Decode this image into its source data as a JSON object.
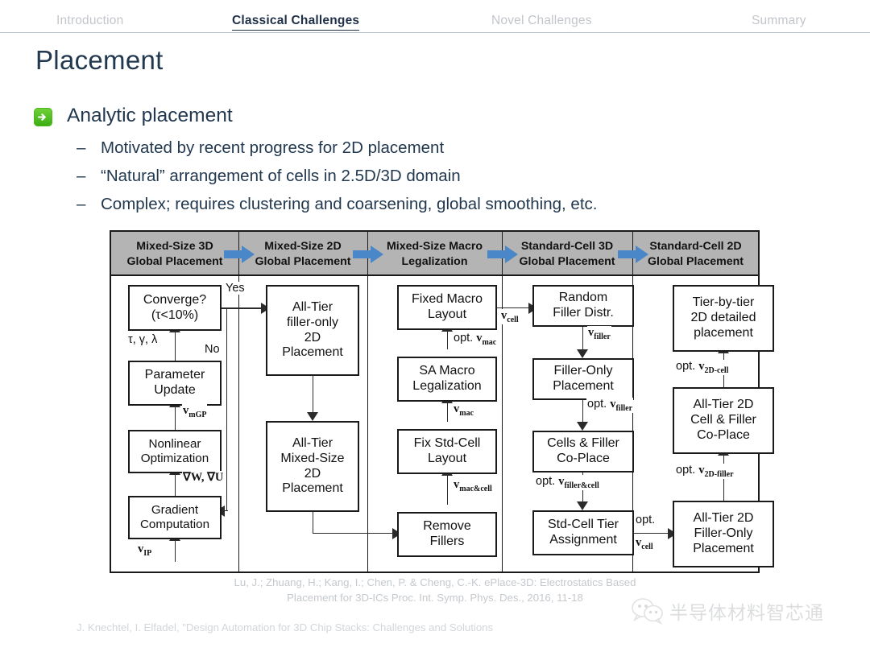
{
  "nav": {
    "items": [
      {
        "label": "Introduction",
        "active": false
      },
      {
        "label": "Classical Challenges",
        "active": true
      },
      {
        "label": "Novel Challenges",
        "active": false
      },
      {
        "label": "Summary",
        "active": false
      }
    ]
  },
  "slide": {
    "title": "Placement",
    "bullet1": "Analytic placement",
    "bullet1_icon": "green-arrow-bullet-icon",
    "sub_bullets": [
      "Motivated by recent progress for 2D placement",
      "“Natural” arrangement of cells in 2.5D/3D domain",
      "Complex; requires clustering and coarsening, global smoothing, etc."
    ]
  },
  "diagram": {
    "headers": [
      {
        "line1": "Mixed-Size 3D",
        "line2": "Global Placement"
      },
      {
        "line1": "Mixed-Size 2D",
        "line2": "Global Placement"
      },
      {
        "line1": "Mixed-Size Macro",
        "line2": "Legalization"
      },
      {
        "line1": "Standard-Cell 3D",
        "line2": "Global Placement"
      },
      {
        "line1": "Standard-Cell 2D",
        "line2": "Global Placement"
      }
    ],
    "col1": {
      "boxes": [
        {
          "line1": "Converge?",
          "line2": "(τ<10%)"
        },
        {
          "line1": "Parameter",
          "line2": "Update"
        },
        {
          "line1": "Nonlinear",
          "line2": "Optimization"
        },
        {
          "line1": "Gradient",
          "line2": "Computation"
        }
      ],
      "edge_params": "τ, γ, λ",
      "edge_vmgp_v": "v",
      "edge_vmgp_sub": "mGP",
      "edge_grad": "∇W, ∇U",
      "edge_vip_v": "v",
      "edge_vip_sub": "IP",
      "yes": "Yes",
      "no": "No"
    },
    "col2": {
      "boxes": [
        {
          "lines": [
            "All-Tier",
            "filler-only",
            "2D",
            "Placement"
          ]
        },
        {
          "lines": [
            "All-Tier",
            "Mixed-Size",
            "2D",
            "Placement"
          ]
        }
      ]
    },
    "col3": {
      "boxes": [
        {
          "line1": "Fixed Macro",
          "line2": "Layout"
        },
        {
          "line1": "SA Macro",
          "line2": "Legalization"
        },
        {
          "line1": "Fix Std-Cell",
          "line2": "Layout"
        },
        {
          "line1": "Remove",
          "line2": "Fillers"
        }
      ],
      "edge_optvmac_pre": "opt. ",
      "edge_optvmac_v": "v",
      "edge_optvmac_sub": "mac",
      "edge_vmac_v": "v",
      "edge_vmac_sub": "mac",
      "edge_vmaccell_v": "v",
      "edge_vmaccell_sub": "mac&cell",
      "edge_vcell_v": "v",
      "edge_vcell_sub": "cell"
    },
    "col4": {
      "boxes": [
        {
          "line1": "Random",
          "line2": "Filler Distr."
        },
        {
          "line1": "Filler-Only",
          "line2": "Placement"
        },
        {
          "line1": "Cells & Filler",
          "line2": "Co-Place"
        },
        {
          "line1": "Std-Cell Tier",
          "line2": "Assignment"
        }
      ],
      "edge_vfiller_v": "v",
      "edge_vfiller_sub": "filler",
      "edge_optvfiller_pre": "opt. ",
      "edge_optvfiller_v": "v",
      "edge_optvfiller_sub": "filler",
      "edge_optvfc_pre": "opt. ",
      "edge_optvfc_v": "v",
      "edge_optvfc_sub": "filler&cell",
      "edge_optvcell_pre": "opt.",
      "edge_optvcell_v": "v",
      "edge_optvcell_sub": "cell"
    },
    "col5": {
      "boxes": [
        {
          "lines": [
            "Tier-by-tier",
            "2D detailed",
            "placement"
          ]
        },
        {
          "lines": [
            "All-Tier 2D",
            "Cell & Filler",
            "Co-Place"
          ]
        },
        {
          "lines": [
            "All-Tier 2D",
            "Filler-Only",
            "Placement"
          ]
        }
      ],
      "edge_2dcell_pre": "opt. ",
      "edge_2dcell_v": "v",
      "edge_2dcell_sub": "2D-cell",
      "edge_2dfiller_pre": "opt. ",
      "edge_2dfiller_v": "v",
      "edge_2dfiller_sub": "2D-filler"
    }
  },
  "citation": {
    "line1": "Lu, J.; Zhuang, H.; Kang, I.; Chen, P. & Cheng, C.-K. ePlace-3D: Electrostatics Based",
    "line2": "Placement for 3D-ICs Proc. Int. Symp. Phys. Des., 2016, 11-18"
  },
  "footer": {
    "note": "J. Knechtel, I. Elfadel, \"Design Automation for 3D Chip Stacks: Challenges and Solutions"
  },
  "watermark": {
    "text": "半导体材料智芯通",
    "icon": "wechat-icon"
  },
  "colors": {
    "accent_green": "#4eb81c",
    "header_band": "#b4b4b4",
    "arrow_blue": "#4a87c8",
    "text_dark": "#22384f",
    "muted": "#c2c6cb"
  }
}
